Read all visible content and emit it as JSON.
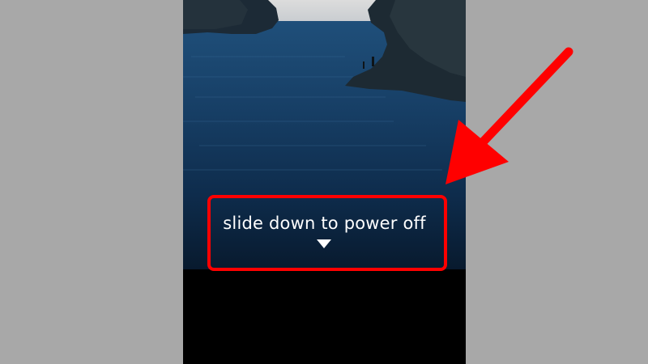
{
  "power_screen": {
    "instruction": "slide down to power off",
    "arrow_icon": "triangle-down-icon"
  },
  "annotation": {
    "highlight_color": "#ff0000",
    "arrow_color": "#ff0000"
  },
  "colors": {
    "background": "#a8a8a8",
    "sea_dark": "#0a2440",
    "sea_light": "#1f4f7a",
    "bottom_panel": "#000000"
  }
}
